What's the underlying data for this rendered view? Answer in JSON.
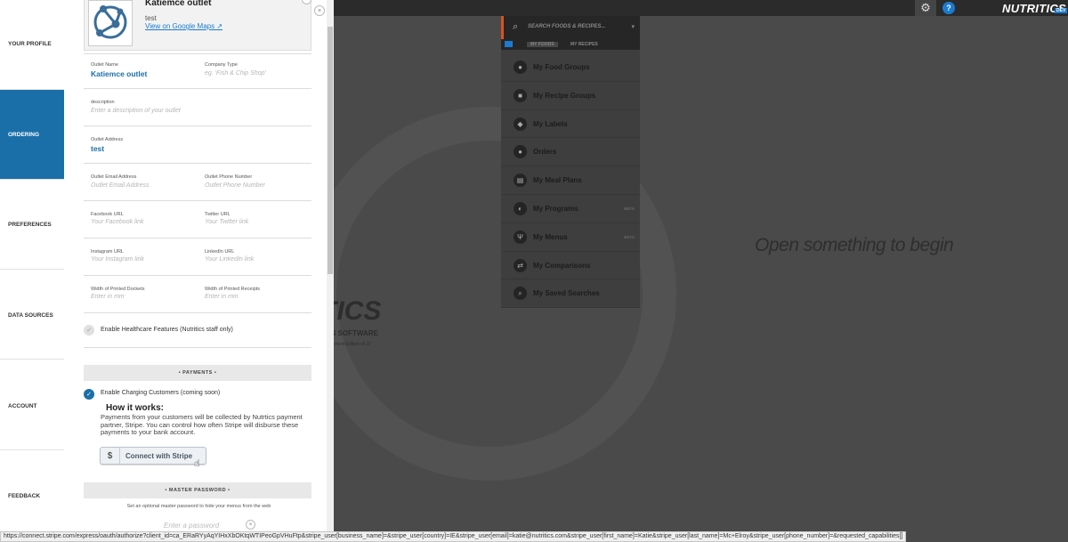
{
  "topbar": {
    "brand": "NUTRITICS",
    "brand_badge": "DEV",
    "help_glyph": "?",
    "icons": [
      "gear-icon",
      "help-icon"
    ]
  },
  "nav": {
    "items": [
      {
        "label": "YOUR PROFILE",
        "active": false
      },
      {
        "label": "ORDERING",
        "active": true
      },
      {
        "label": "PREFERENCES",
        "active": false
      },
      {
        "label": "DATA SOURCES",
        "active": false
      },
      {
        "label": "ACCOUNT",
        "active": false
      },
      {
        "label": "FEEDBACK",
        "active": false
      }
    ]
  },
  "outlet": {
    "name": "Katiemce outlet",
    "subtitle": "test",
    "map_link": "View on Google Maps ↗",
    "close_glyph": "×"
  },
  "form": {
    "outlet_name_label": "Outlet Name",
    "outlet_name_value": "Katiemce outlet",
    "company_type_label": "Company Type",
    "company_type_placeholder": "eg. 'Fish & Chip Shop'",
    "description_label": "description",
    "description_placeholder": "Enter a description of your outlet",
    "address_label": "Outlet Address",
    "address_value": "test",
    "email_label": "Outlet Email Address",
    "email_placeholder": "Outlet Email Address",
    "phone_label": "Outlet Phone Number",
    "phone_placeholder": "Outlet Phone Number",
    "facebook_label": "Facebook URL",
    "facebook_placeholder": "Your Facebook link",
    "twitter_label": "Twitter URL",
    "twitter_placeholder": "Your Twitter link",
    "instagram_label": "Instagram URL",
    "instagram_placeholder": "Your Instagram link",
    "linkedin_label": "LinkedIn URL",
    "linkedin_placeholder": "Your LinkedIn link",
    "dockets_label": "Width of Printed Dockets",
    "dockets_placeholder": "Enter in mm",
    "receipts_label": "Width of Printed Receipts",
    "receipts_placeholder": "Enter in mm",
    "healthcare_label": "Enable Healthcare Features (Nutritics staff only)",
    "healthcare_checked": false
  },
  "payments": {
    "section_title": "• PAYMENTS •",
    "charging_label": "Enable Charging Customers (coming soon)",
    "charging_checked": true,
    "how_title": "How it works:",
    "how_text": "Payments from your customers will be collected by Nutrtics payment partner, Stripe. You can control how often Stripe will disburse these payments to your bank account.",
    "stripe_button": "Connect with Stripe",
    "stripe_icon_glyph": "$"
  },
  "master_password": {
    "section_title": "• MASTER PASSWORD •",
    "hint": "Set an optional master password to hide your menus from the web",
    "placeholder": "Enter a password",
    "clear_glyph": "×"
  },
  "search": {
    "placeholder": "SEARCH FOODS & RECIPES...",
    "tabs": [
      {
        "label": "MY FOODS",
        "active": true
      },
      {
        "label": "MY RECIPES",
        "active": false
      }
    ]
  },
  "menu": {
    "items": [
      {
        "label": "My Food Groups",
        "icon": "apple-icon",
        "glyph": "●",
        "beta": ""
      },
      {
        "label": "My Recipe Groups",
        "icon": "pot-icon",
        "glyph": "■",
        "beta": ""
      },
      {
        "label": "My Labels",
        "icon": "label-icon",
        "glyph": "◆",
        "beta": ""
      },
      {
        "label": "Orders",
        "icon": "orders-icon",
        "glyph": "●",
        "beta": ""
      },
      {
        "label": "My Meal Plans",
        "icon": "calendar-icon",
        "glyph": "▤",
        "beta": ""
      },
      {
        "label": "My Programs",
        "icon": "programs-icon",
        "glyph": "◐",
        "beta": "BETA"
      },
      {
        "label": "My Menus",
        "icon": "menus-icon",
        "glyph": "Ψ",
        "beta": "BETA"
      },
      {
        "label": "My Comparisons",
        "icon": "comparisons-icon",
        "glyph": "⇄",
        "beta": ""
      },
      {
        "label": "My Saved Searches",
        "icon": "saved-search-icon",
        "glyph": "⌕",
        "beta": ""
      }
    ]
  },
  "workspace": {
    "empty_message": "Open something to begin",
    "watermark_logo": "TICS",
    "watermark_sub": "S SOFTWARE",
    "watermark_ver": "ment Edition v3.37"
  },
  "status_bar": {
    "url": "https://connect.stripe.com/express/oauth/authorize?client_id=ca_ERaRYyAqYIHxXbOKtqWTIPeoGpVHuFtp&stripe_user[business_name]=&stripe_user[country]=IE&stripe_user[email]=katie@nutritics.com&stripe_user[first_name]=Katie&stripe_user[last_name]=Mc+Elroy&stripe_user[phone_number]=&requested_capabilities[]"
  }
}
